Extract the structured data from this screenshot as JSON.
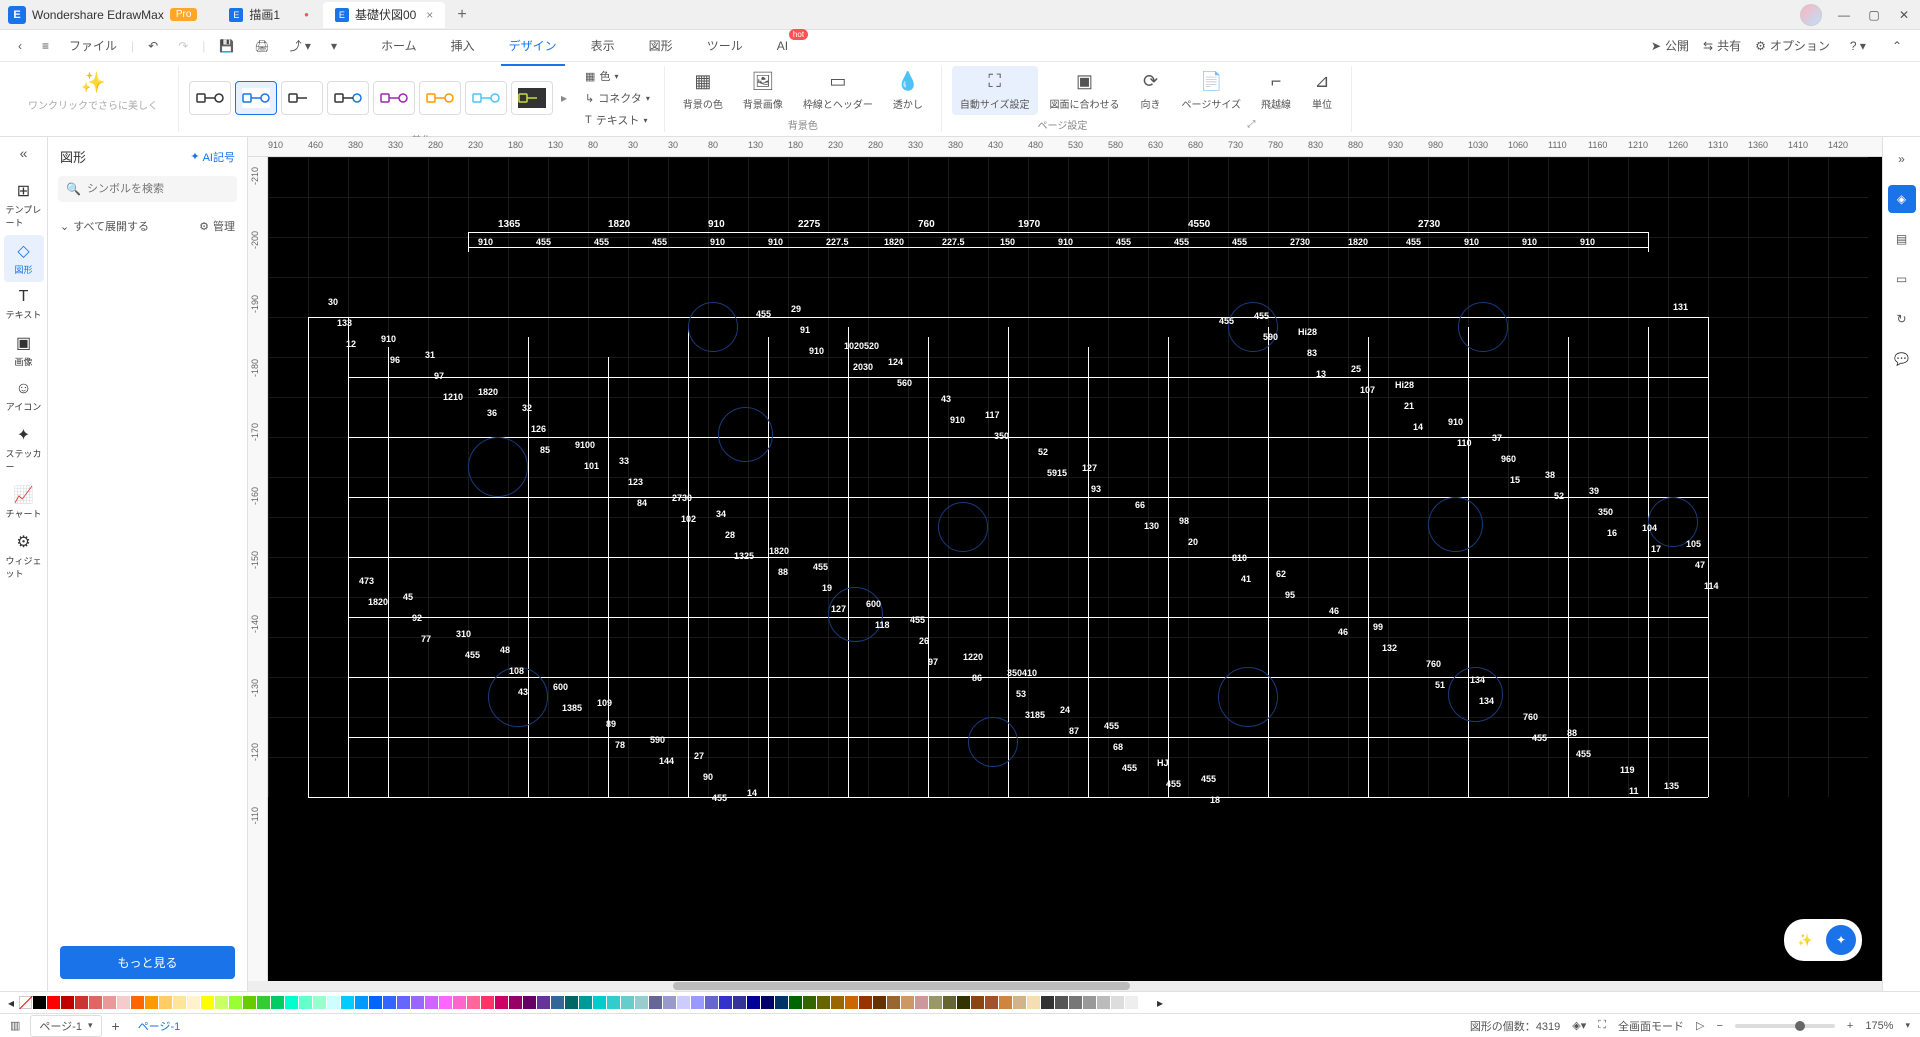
{
  "app": {
    "name": "Wondershare EdrawMax",
    "badge": "Pro"
  },
  "tabs": [
    {
      "label": "描画1",
      "active": false,
      "dirty": true
    },
    {
      "label": "基礎伏図00",
      "active": true,
      "dirty": false
    }
  ],
  "menubar": {
    "file": "ファイル",
    "main_tabs": [
      "ホーム",
      "挿入",
      "デザイン",
      "表示",
      "図形",
      "ツール",
      "AI"
    ],
    "active_tab_index": 2,
    "hot_index": 6,
    "hot_label": "hot",
    "right": {
      "publish": "公開",
      "share": "共有",
      "options": "オプション"
    }
  },
  "ribbon": {
    "ai_beautify": "ワンクリックでさらに美しく",
    "groups": {
      "beautify": "美化",
      "background": "背景色",
      "page": "ページ設定"
    },
    "col1": {
      "color": "色",
      "connector": "コネクタ",
      "text": "テキスト"
    },
    "bg_buttons": [
      "背景の色",
      "背景画像",
      "枠線とヘッダー",
      "透かし"
    ],
    "page_buttons": [
      "自動サイズ設定",
      "図面に合わせる",
      "向き",
      "ページサイズ",
      "飛越線",
      "単位"
    ],
    "page_active_index": 0
  },
  "left_rail": {
    "items": [
      {
        "label": "テンプレート",
        "icon": "⊞"
      },
      {
        "label": "図形",
        "icon": "◇",
        "active": true
      },
      {
        "label": "テキスト",
        "icon": "T"
      },
      {
        "label": "画像",
        "icon": "▣"
      },
      {
        "label": "アイコン",
        "icon": "☺"
      },
      {
        "label": "ステッカー",
        "icon": "✦"
      },
      {
        "label": "チャート",
        "icon": "📈"
      },
      {
        "label": "ウィジェット",
        "icon": "⚙"
      }
    ]
  },
  "shapes_panel": {
    "title": "図形",
    "ai_symbol": "AI記号",
    "search_placeholder": "シンボルを検索",
    "expand_all": "すべて展開する",
    "manage": "管理",
    "more": "もっと見る"
  },
  "ruler_h": [
    "910",
    "460",
    "380",
    "330",
    "280",
    "230",
    "180",
    "130",
    "80",
    "30",
    "30",
    "80",
    "130",
    "180",
    "230",
    "280",
    "330",
    "380",
    "430",
    "480",
    "530",
    "580",
    "630",
    "680",
    "730",
    "780",
    "830",
    "880",
    "930",
    "980",
    "1030",
    "1060",
    "1110",
    "1160",
    "1210",
    "1260",
    "1310",
    "1360",
    "1410",
    "1420"
  ],
  "ruler_v": [
    "-210",
    "-200",
    "-190",
    "-180",
    "-170",
    "-160",
    "-150",
    "-140",
    "-130",
    "-120",
    "-110"
  ],
  "drawing": {
    "top_dims": [
      "1365",
      "1820",
      "910",
      "2275",
      "760",
      "1970",
      "4550",
      "2730"
    ],
    "sub_dims": [
      "910",
      "455",
      "455",
      "455",
      "910",
      "910",
      "227.5",
      "1820",
      "227.5",
      "150",
      "910",
      "455",
      "455",
      "455",
      "2730",
      "1820",
      "455",
      "910",
      "910",
      "910"
    ],
    "grid_nums": [
      "30",
      "31",
      "32",
      "33",
      "34",
      "455",
      "455",
      "350410",
      "455",
      "455",
      "Hi28",
      "Hi28",
      "37",
      "39",
      "105",
      "45",
      "48",
      "109",
      "27",
      "29",
      "124",
      "117",
      "127",
      "98",
      "62",
      "99",
      "134",
      "88",
      "135",
      "910",
      "1820",
      "9100",
      "2730",
      "1820",
      "600",
      "1220",
      "24",
      "HJ",
      "455",
      "25",
      "910",
      "38",
      "104",
      "473",
      "310",
      "600",
      "590",
      "14",
      "1020520",
      "43",
      "52",
      "66",
      "810",
      "46",
      "760",
      "760",
      "119",
      "133",
      "97",
      "126",
      "123",
      "28",
      "19",
      "26",
      "53",
      "68",
      "18",
      "83",
      "21",
      "960",
      "350",
      "47",
      "92",
      "108",
      "89",
      "90",
      "91",
      "560",
      "350",
      "93",
      "20",
      "95",
      "132",
      "134",
      "455",
      "131",
      "96",
      "36",
      "101",
      "102",
      "88",
      "118",
      "86",
      "87",
      "455",
      "590",
      "107",
      "110",
      "52",
      "17",
      "1820",
      "455",
      "1385",
      "144",
      "455",
      "2030",
      "910",
      "5915",
      "130",
      "41",
      "46",
      "51",
      "455",
      "11",
      "12",
      "1210",
      "85",
      "84",
      "1325",
      "127",
      "97",
      "3185",
      "455",
      "455",
      "13",
      "14",
      "15",
      "16",
      "114",
      "77",
      "43",
      "78",
      "455",
      "910"
    ],
    "scrollbar": {
      "left_pct": 26,
      "width_pct": 28
    }
  },
  "colors": [
    "#000000",
    "#ff0000",
    "#c00000",
    "#cc3333",
    "#e06666",
    "#ea9999",
    "#f4cccc",
    "#ff6600",
    "#ff9900",
    "#ffcc66",
    "#ffe599",
    "#fff2cc",
    "#ffff00",
    "#ccff66",
    "#99ff33",
    "#66cc00",
    "#33cc33",
    "#00cc66",
    "#00ffcc",
    "#66ffcc",
    "#99ffcc",
    "#ccffff",
    "#00ccff",
    "#0099ff",
    "#0066ff",
    "#3366ff",
    "#6666ff",
    "#9966ff",
    "#cc66ff",
    "#ff66ff",
    "#ff66cc",
    "#ff6699",
    "#ff3366",
    "#cc0066",
    "#990066",
    "#660066",
    "#663399",
    "#336699",
    "#006666",
    "#009999",
    "#00cccc",
    "#33cccc",
    "#66cccc",
    "#99cccc",
    "#666699",
    "#9999cc",
    "#ccccff",
    "#9999ff",
    "#6666cc",
    "#3333cc",
    "#333399",
    "#000099",
    "#000066",
    "#003366",
    "#006600",
    "#336600",
    "#666600",
    "#996600",
    "#cc6600",
    "#993300",
    "#663300",
    "#996633",
    "#cc9966",
    "#cc9999",
    "#999966",
    "#666633",
    "#333300",
    "#8b4513",
    "#a0522d",
    "#cd853f",
    "#d2b48c",
    "#f5deb3",
    "#333333",
    "#555555",
    "#777777",
    "#999999",
    "#bbbbbb",
    "#dddddd",
    "#eeeeee",
    "#ffffff"
  ],
  "statusbar": {
    "page_label": "ページ-1",
    "page_tab": "ページ-1",
    "shape_count_label": "図形の個数：",
    "shape_count": "4319",
    "fullscreen": "全画面モード",
    "zoom": "175%"
  }
}
